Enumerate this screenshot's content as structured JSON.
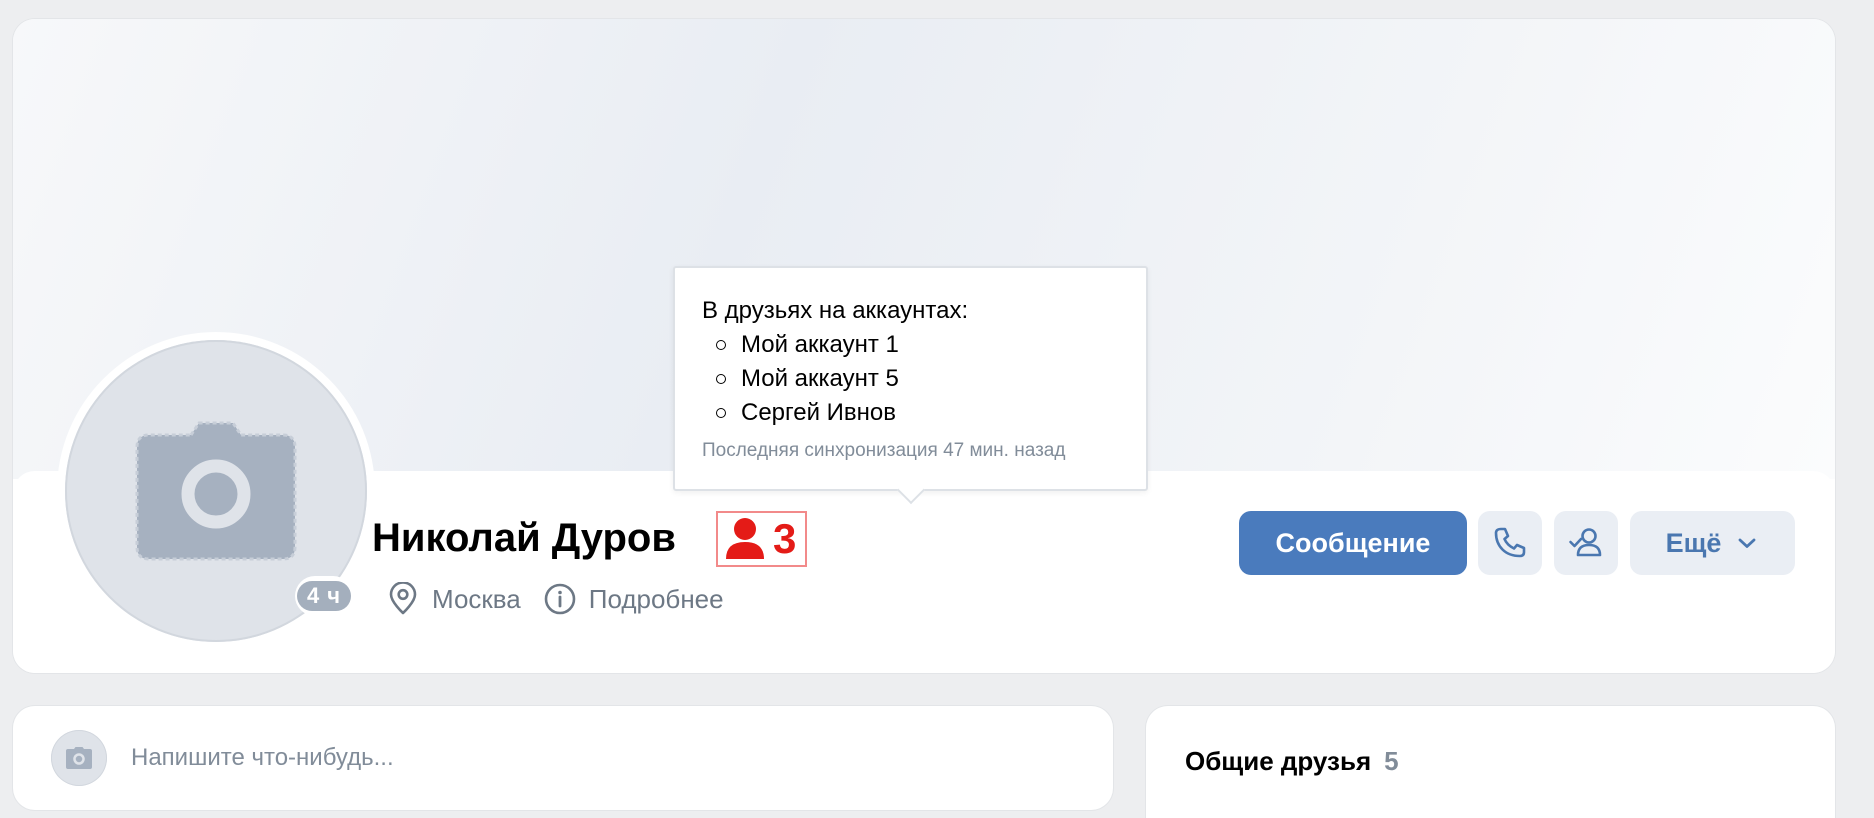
{
  "profile": {
    "name": "Николай Дуров",
    "online_badge": "4 ч",
    "friends_indicator_count": "3",
    "location": "Москва",
    "details_link": "Подробнее"
  },
  "actions": {
    "message_label": "Сообщение",
    "more_label": "Ещё"
  },
  "tooltip": {
    "title": "В друзьях на аккаунтах:",
    "accounts": [
      "Мой аккаунт 1",
      "Мой аккаунт 5",
      "Сергей Ивнов"
    ],
    "sync": "Последняя синхронизация 47 мин. назад"
  },
  "post": {
    "placeholder": "Напишите что-нибудь..."
  },
  "mutual_friends": {
    "title": "Общие друзья",
    "count": "5"
  },
  "colors": {
    "accent": "#4a7bbd",
    "indicator_red": "#e41b17",
    "page_bg": "#edeef0"
  },
  "icons": {
    "avatar": "camera-icon",
    "friends_indicator": "person-icon",
    "location": "location-pin-icon",
    "details": "info-icon",
    "call": "phone-icon",
    "friend_status": "user-check-icon",
    "more": "chevron-down-icon"
  }
}
